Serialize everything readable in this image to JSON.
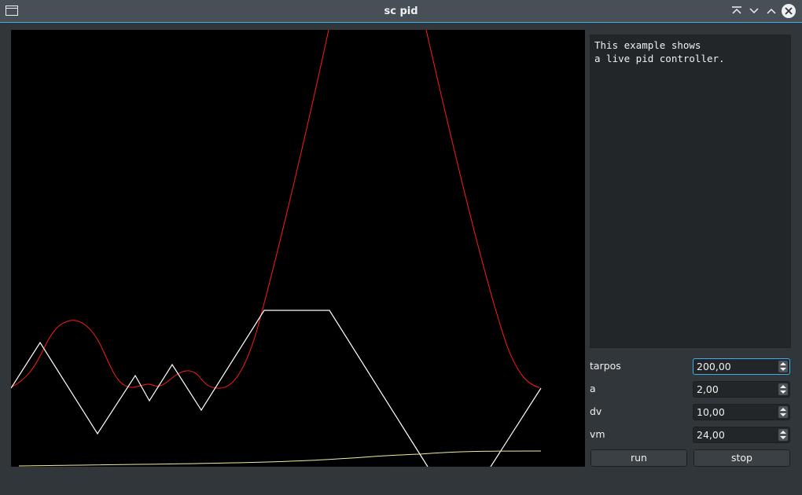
{
  "window": {
    "title": "sc pid",
    "icons": [
      "window-menu-icon",
      "keep-above-icon",
      "minimize-icon",
      "maximize-icon",
      "close-icon"
    ]
  },
  "info_text": "This example shows\na live pid controller.",
  "params": [
    {
      "label": "tarpos",
      "value": "200,00",
      "focused": true
    },
    {
      "label": "a",
      "value": "2,00",
      "focused": false
    },
    {
      "label": "dv",
      "value": "10,00",
      "focused": false
    },
    {
      "label": "vm",
      "value": "24,00",
      "focused": false
    }
  ],
  "buttons": {
    "run": "run",
    "stop": "stop"
  },
  "colors": {
    "red_curve": "#ff1a1a",
    "white_curve": "#ffffff",
    "yellow_curve": "#f0ee9a",
    "plot_bg": "#000000",
    "accent": "#3daee9"
  }
}
